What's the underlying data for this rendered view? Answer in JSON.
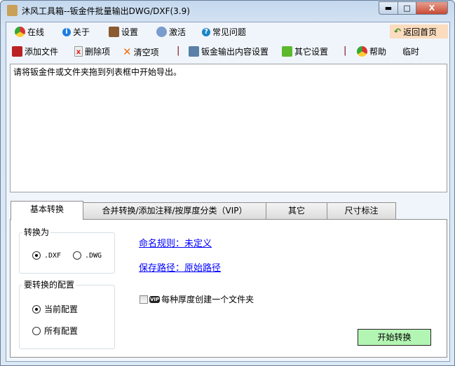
{
  "window": {
    "title": "沐风工具箱--钣金件批量输出DWG/DXF(3.9)",
    "minimize": "▬",
    "maximize": "□",
    "close": "X"
  },
  "menu1": [
    {
      "label": "在线",
      "icon": "chrome-icon"
    },
    {
      "label": "关于",
      "icon": "info-icon"
    },
    {
      "label": "设置",
      "icon": "tools-icon"
    },
    {
      "label": "激活",
      "icon": "key-icon"
    },
    {
      "label": "常见问题",
      "icon": "help-icon"
    }
  ],
  "home": {
    "label": "返回首页",
    "icon": "back-arrow-icon"
  },
  "menu2": [
    {
      "label": "添加文件",
      "icon": "add-file-icon"
    },
    {
      "label": "删除项",
      "icon": "delete-file-icon"
    },
    {
      "label": "清空项",
      "icon": "x-icon"
    },
    {
      "label": "钣金输出内容设置",
      "icon": "sheetmetal-icon"
    },
    {
      "label": "其它设置",
      "icon": "wrench-icon"
    },
    {
      "label": "帮助",
      "icon": "chrome-icon"
    },
    {
      "label": "临时"
    }
  ],
  "separator": "|",
  "list": {
    "hint": "请将钣金件或文件夹拖到列表框中开始导出。"
  },
  "tabs": [
    "基本转换",
    "合并转换/添加注释/按厚度分类（VIP）",
    "其它",
    "尺寸标注"
  ],
  "convert": {
    "group": "转换为",
    "options": [
      ".DXF",
      ".DWG"
    ],
    "selected": ".DXF"
  },
  "config": {
    "group": "要转换的配置",
    "options": [
      "当前配置",
      "所有配置"
    ],
    "selected": "当前配置"
  },
  "naming_link": "命名规则：未定义",
  "path_link": "保存路径：原始路径",
  "vip_badge": "VIP",
  "checkbox": {
    "label": "每种厚度创建一个文件夹",
    "checked": false
  },
  "start_button": "开始转换"
}
